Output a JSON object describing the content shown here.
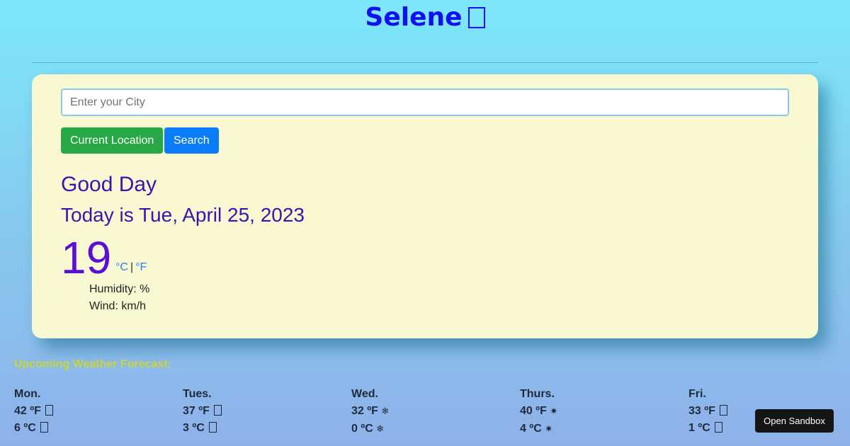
{
  "app": {
    "title": "Selene",
    "title_icon": "moon-icon"
  },
  "search": {
    "placeholder": "Enter your City",
    "value": ""
  },
  "buttons": {
    "current_location": "Current Location",
    "search": "Search"
  },
  "weather": {
    "greeting": "Good Day",
    "date_line": "Today is Tue, April 25, 2023",
    "temperature": "19",
    "unit_c": "°C",
    "unit_sep": "|",
    "unit_f": "°F",
    "humidity": "Humidity: %",
    "wind": "Wind: km/h"
  },
  "forecast": {
    "title": "Upcoming Weather Forecast:",
    "days": [
      {
        "name": "Mon.",
        "high": "42 ºF",
        "high_icon": "missing-glyph",
        "low": "6 ºC",
        "low_icon": "missing-glyph"
      },
      {
        "name": "Tues.",
        "high": "37 ºF",
        "high_icon": "missing-glyph",
        "low": "3 ºC",
        "low_icon": "missing-glyph"
      },
      {
        "name": "Wed.",
        "high": "32 ºF",
        "high_icon": "snowflake-icon",
        "low": "0 ºC",
        "low_icon": "snowflake-icon"
      },
      {
        "name": "Thurs.",
        "high": "40 ºF",
        "high_icon": "sparkle-icon",
        "low": "4 ºC",
        "low_icon": "sparkle-icon"
      },
      {
        "name": "Fri.",
        "high": "33 ºF",
        "high_icon": "missing-glyph",
        "low": "1 ºC",
        "low_icon": "missing-glyph"
      }
    ]
  },
  "sandbox": {
    "label": "Open Sandbox"
  },
  "colors": {
    "title": "#1010f0",
    "card_bg": "#f8f8d2",
    "btn_green": "#28a745",
    "btn_blue": "#0a7cf7",
    "heading": "#3a14b0",
    "temp": "#5a0fd6",
    "forecast_title": "#c8d638"
  }
}
